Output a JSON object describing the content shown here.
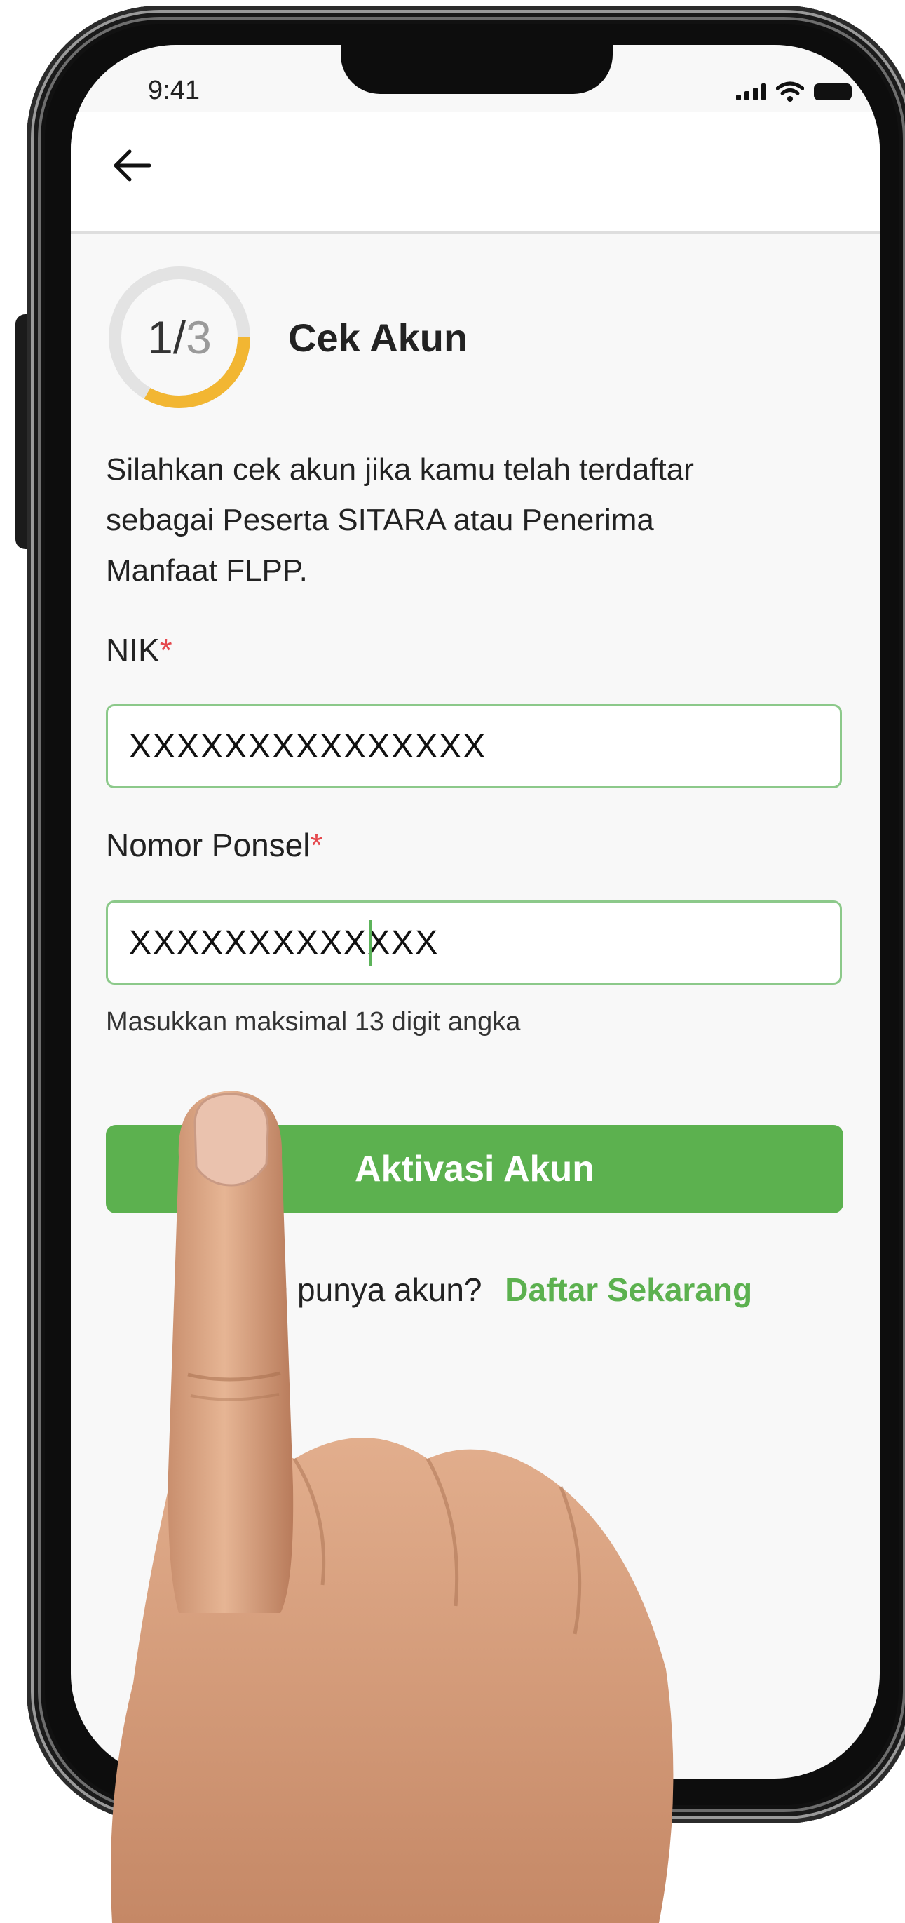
{
  "status_bar": {
    "time": "9:41"
  },
  "header": {
    "back_icon": "arrow-left-icon"
  },
  "step": {
    "current": "1/",
    "total": "3",
    "title": "Cek Akun",
    "progress": 0.333,
    "progress_color": "#f2b632",
    "track_color": "#e3e3e3"
  },
  "description": {
    "line1": "Silahkan cek akun jika kamu telah terdaftar",
    "line2": "sebagai Peserta SITARA atau Penerima",
    "line3": "Manfaat FLPP."
  },
  "nik": {
    "label": "NIK",
    "required_mark": "*",
    "value": "XXXXXXXXXXXXXXX"
  },
  "phone": {
    "label": "Nomor Ponsel",
    "required_mark": "*",
    "value": "XXXXXXXXXXXXX",
    "helper": "Masukkan maksimal 13 digit angka"
  },
  "actions": {
    "activate_label": "Aktivasi Akun",
    "signup_prompt": "Belum punya akun?",
    "signup_link": "Daftar Sekarang"
  },
  "colors": {
    "brand_green": "#5cb14f",
    "required_red": "#e5484d",
    "input_border": "#8cc98a"
  }
}
